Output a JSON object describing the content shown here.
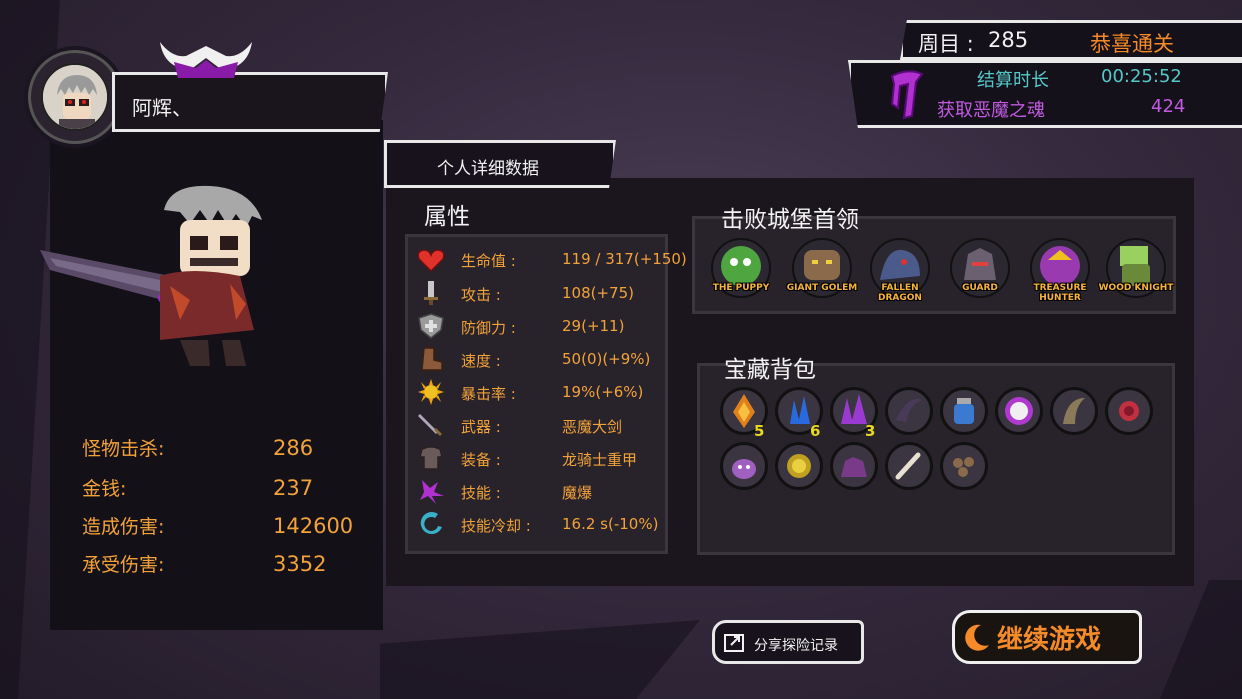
{
  "player": {
    "name": "阿辉、"
  },
  "left_stats": [
    {
      "label": "怪物击杀:",
      "value": "286"
    },
    {
      "label": "金钱:",
      "value": "237"
    },
    {
      "label": "造成伤害:",
      "value": "142600"
    },
    {
      "label": "承受伤害:",
      "value": "3352"
    }
  ],
  "run": {
    "cycle_label": "周目 :",
    "cycle_value": "285",
    "clear_text": "恭喜通关",
    "time_label": "结算时长",
    "time_value": "00:25:52",
    "soul_label": "获取恶魔之魂",
    "soul_value": "424"
  },
  "detail": {
    "tab_label": "个人详细数据",
    "attributes_title": "属性",
    "attributes": [
      {
        "icon": "heart-icon",
        "label": "生命值 :",
        "value": "119 / 317(+150)"
      },
      {
        "icon": "sword-icon",
        "label": "攻击 :",
        "value": "108(+75)"
      },
      {
        "icon": "shield-icon",
        "label": "防御力 :",
        "value": "29(+11)"
      },
      {
        "icon": "boot-icon",
        "label": "速度 :",
        "value": "50(0)(+9%)"
      },
      {
        "icon": "crit-icon",
        "label": "暴击率 :",
        "value": "19%(+6%)"
      },
      {
        "icon": "weapon-icon",
        "label": "武器 :",
        "value": "恶魔大剑"
      },
      {
        "icon": "armor-icon",
        "label": "装备 :",
        "value": "龙骑士重甲"
      },
      {
        "icon": "skill-icon",
        "label": "技能 :",
        "value": "魔爆"
      },
      {
        "icon": "cooldown-icon",
        "label": "技能冷却 :",
        "value": "16.2 s(-10%)"
      }
    ],
    "bosses_title": "击败城堡首领",
    "bosses": [
      {
        "name": "THE PUPPY",
        "color": "#4fa640"
      },
      {
        "name": "GIANT GOLEM",
        "color": "#8a6a4a"
      },
      {
        "name": "FALLEN DRAGON",
        "color": "#4a5a8a"
      },
      {
        "name": "GUARD",
        "color": "#6a6070"
      },
      {
        "name": "TREASURE HUNTER",
        "color": "#9a3ab0"
      },
      {
        "name": "WOOD KNIGHT",
        "color": "#6a8a3a"
      }
    ],
    "treasure_title": "宝藏背包",
    "treasure_row1": [
      {
        "icon": "fire-crystal-icon",
        "color": "#e0801a",
        "count": "5"
      },
      {
        "icon": "ice-crystal-icon",
        "color": "#2a6ae0",
        "count": "6"
      },
      {
        "icon": "purple-crystal-icon",
        "color": "#9a3ad0",
        "count": "3"
      },
      {
        "icon": "claw-icon",
        "color": "#4a3a5a",
        "count": ""
      },
      {
        "icon": "potion-jar-icon",
        "color": "#3a7ad0",
        "count": ""
      },
      {
        "icon": "white-orb-icon",
        "color": "#b03ad0",
        "count": ""
      },
      {
        "icon": "horn-icon",
        "color": "#6a5a4a",
        "count": ""
      },
      {
        "icon": "rose-icon",
        "color": "#6a2a5a",
        "count": ""
      }
    ],
    "treasure_row2": [
      {
        "icon": "slime-pet-icon",
        "color": "#3a9a3a",
        "count": ""
      },
      {
        "icon": "gold-coin-icon",
        "color": "#c0a020",
        "count": ""
      },
      {
        "icon": "beast-icon",
        "color": "#7a3a8a",
        "count": ""
      },
      {
        "icon": "bone-icon",
        "color": "#5a5560",
        "count": ""
      },
      {
        "icon": "rock-cluster-icon",
        "color": "#8a3ab0",
        "count": ""
      }
    ]
  },
  "buttons": {
    "share_label": "分享探险记录",
    "continue_label": "继续游戏"
  },
  "colors": {
    "accent_orange": "#f2a23a",
    "clear_orange": "#f58a28",
    "time_cyan": "#56c8c8",
    "soul_purple": "#c05ae0"
  }
}
